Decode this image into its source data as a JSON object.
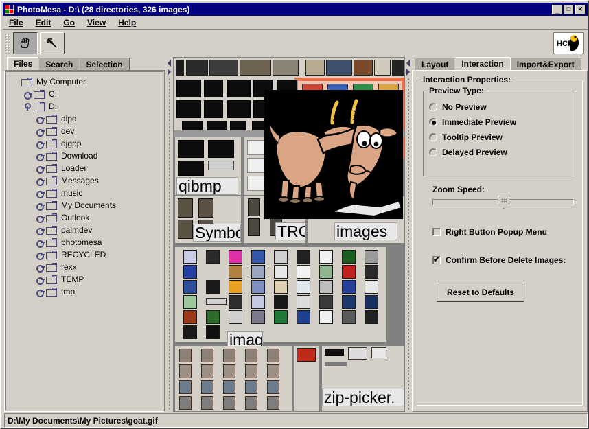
{
  "window": {
    "title": "PhotoMesa - D:\\ (28 directories, 326 images)",
    "minimize_label": "_",
    "maximize_label": "□",
    "close_label": "✕"
  },
  "menu": {
    "items": [
      {
        "label": "File",
        "mnemonic": "F"
      },
      {
        "label": "Edit",
        "mnemonic": "E"
      },
      {
        "label": "Go",
        "mnemonic": "G"
      },
      {
        "label": "View",
        "mnemonic": "V"
      },
      {
        "label": "Help",
        "mnemonic": "H"
      }
    ]
  },
  "toolbar": {
    "pan_tool": "hand-tool",
    "select_tool": "arrow-tool",
    "logo_text": "HCIL"
  },
  "left_panel": {
    "tabs": [
      {
        "label": "Files",
        "selected": true
      },
      {
        "label": "Search",
        "selected": false
      },
      {
        "label": "Selection",
        "selected": false
      }
    ],
    "tree": [
      {
        "label": "My Computer",
        "depth": 0,
        "handle": "none"
      },
      {
        "label": "C:",
        "depth": 1,
        "handle": "collapsed"
      },
      {
        "label": "D:",
        "depth": 1,
        "handle": "expanded"
      },
      {
        "label": "aipd",
        "depth": 2,
        "handle": "collapsed"
      },
      {
        "label": "dev",
        "depth": 2,
        "handle": "collapsed"
      },
      {
        "label": "djgpp",
        "depth": 2,
        "handle": "collapsed"
      },
      {
        "label": "Download",
        "depth": 2,
        "handle": "collapsed"
      },
      {
        "label": "Loader",
        "depth": 2,
        "handle": "collapsed"
      },
      {
        "label": "Messages",
        "depth": 2,
        "handle": "collapsed"
      },
      {
        "label": "music",
        "depth": 2,
        "handle": "collapsed"
      },
      {
        "label": "My Documents",
        "depth": 2,
        "handle": "collapsed"
      },
      {
        "label": "Outlook",
        "depth": 2,
        "handle": "collapsed"
      },
      {
        "label": "palmdev",
        "depth": 2,
        "handle": "collapsed"
      },
      {
        "label": "photomesa",
        "depth": 2,
        "handle": "collapsed"
      },
      {
        "label": "RECYCLED",
        "depth": 2,
        "handle": "collapsed"
      },
      {
        "label": "rexx",
        "depth": 2,
        "handle": "collapsed"
      },
      {
        "label": "TEMP",
        "depth": 2,
        "handle": "collapsed"
      },
      {
        "label": "tmp",
        "depth": 2,
        "handle": "collapsed"
      }
    ]
  },
  "right_panel": {
    "tabs": [
      {
        "label": "Layout",
        "selected": false
      },
      {
        "label": "Interaction",
        "selected": true
      },
      {
        "label": "Import&Export",
        "selected": false
      }
    ],
    "properties_group_title": "Interaction Properties:",
    "preview_group_title": "Preview Type:",
    "preview_options": [
      {
        "label": "No Preview",
        "selected": false
      },
      {
        "label": "Immediate Preview",
        "selected": true
      },
      {
        "label": "Tooltip Preview",
        "selected": false
      },
      {
        "label": "Delayed Preview",
        "selected": false
      }
    ],
    "zoom_speed_label": "Zoom Speed:",
    "zoom_speed_percent": 50,
    "checkboxes": [
      {
        "label": "Right Button Popup Menu",
        "checked": false
      },
      {
        "label": "Confirm Before Delete Images:",
        "checked": true
      }
    ],
    "reset_button": "Reset to Defaults"
  },
  "image_area": {
    "group_labels": [
      "qibmp",
      "Symbol",
      "TRG",
      "images",
      "images",
      "zip-picker."
    ],
    "preview_image": "goat-cartoon"
  },
  "status_bar": {
    "path": "D:\\My Documents\\My Pictures\\goat.gif"
  },
  "colors": {
    "titlebar": "#000080",
    "face": "#d4d0c8",
    "selection": "#e8704a",
    "panel_bg": "#808080"
  }
}
